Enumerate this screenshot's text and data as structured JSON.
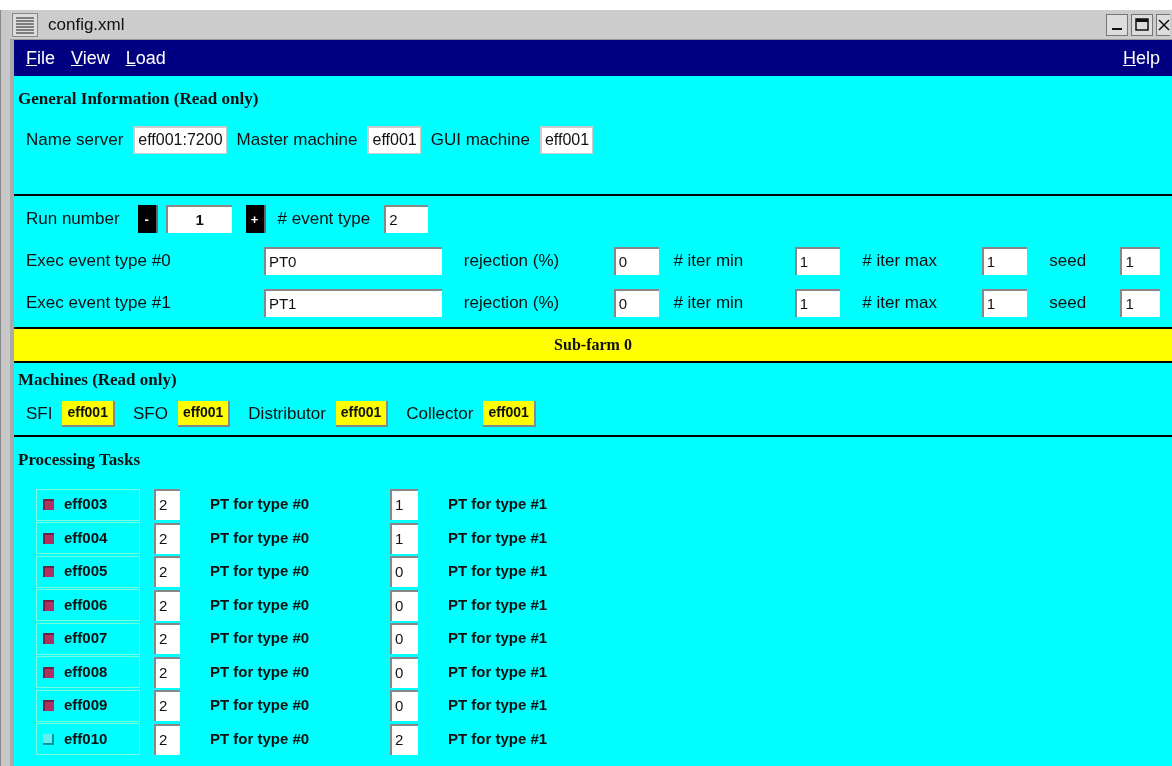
{
  "window": {
    "title": "config.xml"
  },
  "menu": {
    "left": [
      "File",
      "View",
      "Load"
    ],
    "right": [
      "Help"
    ]
  },
  "general": {
    "title": "General Information (Read only)",
    "fields": [
      {
        "label": "Name server",
        "value": "eff001:7200"
      },
      {
        "label": "Master machine",
        "value": "eff001"
      },
      {
        "label": "GUI machine",
        "value": "eff001"
      }
    ]
  },
  "run": {
    "label": "Run number",
    "minus": "-",
    "value": "1",
    "plus": "+",
    "event_type_label": "# event type",
    "event_type_value": "2"
  },
  "exec_rows": [
    {
      "label": "Exec event type #0",
      "name": "PT0",
      "rejection_label": "rejection (%)",
      "rejection": "0",
      "iter_min_label": "# iter min",
      "iter_min": "1",
      "iter_max_label": "# iter max",
      "iter_max": "1",
      "seed_label": "seed",
      "seed": "1"
    },
    {
      "label": "Exec event type #1",
      "name": "PT1",
      "rejection_label": "rejection (%)",
      "rejection": "0",
      "iter_min_label": "# iter min",
      "iter_min": "1",
      "iter_max_label": "# iter max",
      "iter_max": "1",
      "seed_label": "seed",
      "seed": "1"
    }
  ],
  "subfarm": {
    "title": "Sub-farm 0"
  },
  "machines": {
    "title": "Machines (Read only)",
    "items": [
      {
        "label": "SFI",
        "value": "eff001"
      },
      {
        "label": "SFO",
        "value": "eff001"
      },
      {
        "label": "Distributor",
        "value": "eff001"
      },
      {
        "label": "Collector",
        "value": "eff001"
      }
    ]
  },
  "tasks": {
    "title": "Processing Tasks",
    "rows": [
      {
        "host": "eff003",
        "checked": true,
        "pt0": "2",
        "pt0_label": "PT for type #0",
        "pt1": "1",
        "pt1_label": "PT for type #1"
      },
      {
        "host": "eff004",
        "checked": true,
        "pt0": "2",
        "pt0_label": "PT for type #0",
        "pt1": "1",
        "pt1_label": "PT for type #1"
      },
      {
        "host": "eff005",
        "checked": true,
        "pt0": "2",
        "pt0_label": "PT for type #0",
        "pt1": "0",
        "pt1_label": "PT for type #1"
      },
      {
        "host": "eff006",
        "checked": true,
        "pt0": "2",
        "pt0_label": "PT for type #0",
        "pt1": "0",
        "pt1_label": "PT for type #1"
      },
      {
        "host": "eff007",
        "checked": true,
        "pt0": "2",
        "pt0_label": "PT for type #0",
        "pt1": "0",
        "pt1_label": "PT for type #1"
      },
      {
        "host": "eff008",
        "checked": true,
        "pt0": "2",
        "pt0_label": "PT for type #0",
        "pt1": "0",
        "pt1_label": "PT for type #1"
      },
      {
        "host": "eff009",
        "checked": true,
        "pt0": "2",
        "pt0_label": "PT for type #0",
        "pt1": "0",
        "pt1_label": "PT for type #1"
      },
      {
        "host": "eff010",
        "checked": false,
        "pt0": "2",
        "pt0_label": "PT for type #0",
        "pt1": "2",
        "pt1_label": "PT for type #1"
      }
    ]
  }
}
